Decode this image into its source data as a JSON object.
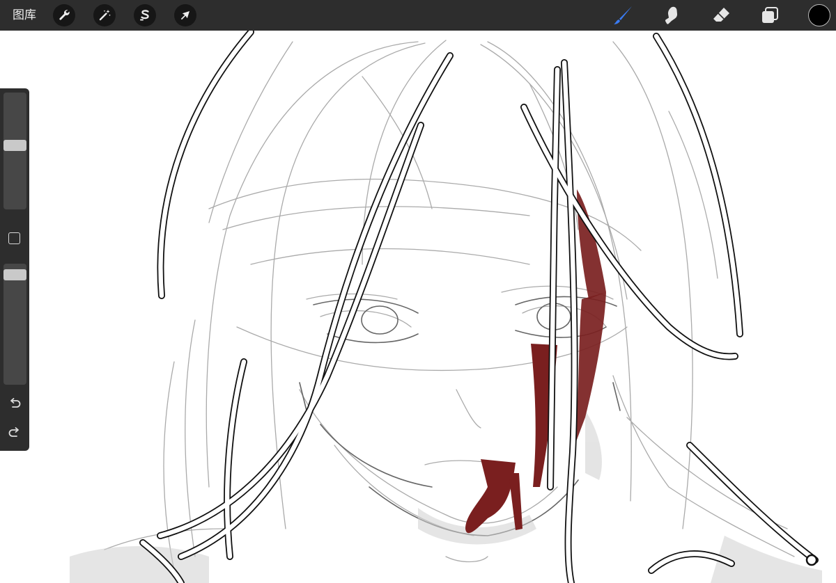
{
  "toolbar": {
    "gallery_label": "图库",
    "left_tools": [
      {
        "name": "actions",
        "icon": "wrench-icon"
      },
      {
        "name": "adjustments",
        "icon": "magic-wand-icon"
      },
      {
        "name": "selection",
        "icon": "selection-s-icon"
      },
      {
        "name": "transform",
        "icon": "transform-arrow-icon"
      }
    ],
    "right_tools": [
      {
        "name": "brush",
        "icon": "brush-icon",
        "active": true
      },
      {
        "name": "smudge",
        "icon": "smudge-finger-icon",
        "active": false
      },
      {
        "name": "eraser",
        "icon": "eraser-icon",
        "active": false
      },
      {
        "name": "layers",
        "icon": "layers-icon",
        "active": false
      }
    ],
    "current_color": "#000000",
    "accent_color": "#3a7bf2"
  },
  "sidebar": {
    "brush_size": 0.55,
    "brush_opacity": 0.95,
    "modifier_icon": "square-modifier-icon",
    "undo_icon": "undo-icon",
    "redo_icon": "redo-icon"
  },
  "canvas": {
    "background": "#ffffff",
    "ink_color": "#1a1a1a",
    "sketch_color": "#a8a8a8",
    "blood_color": "#7a1f1f"
  }
}
